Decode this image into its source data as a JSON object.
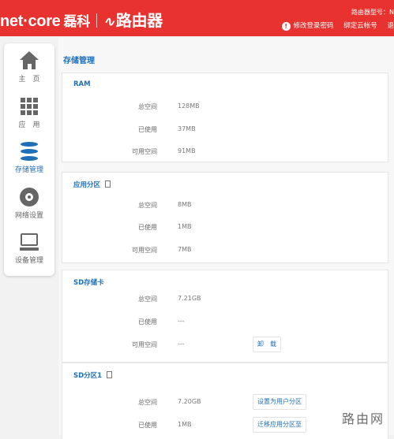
{
  "header": {
    "brand": "net·core",
    "brand_cn": "磊科",
    "product_icon": "∿",
    "product": "路由器",
    "model_label": "路由器型号：N",
    "link_password": "修改登录密码",
    "link_cloud": "绑定云帐号",
    "link_exit": "退"
  },
  "sidebar": {
    "items": [
      {
        "label": "主　页",
        "icon": "home-icon"
      },
      {
        "label": "应　用",
        "icon": "apps-grid-icon"
      },
      {
        "label": "存储管理",
        "icon": "storage-icon"
      },
      {
        "label": "网络设置",
        "icon": "network-gear-icon"
      },
      {
        "label": "设备管理",
        "icon": "device-icon"
      }
    ],
    "active_index": 2
  },
  "main": {
    "title": "存储管理",
    "sections": [
      {
        "title": "RAM",
        "rows": [
          {
            "key": "总空间",
            "value": "128MB"
          },
          {
            "key": "已使用",
            "value": "37MB"
          },
          {
            "key": "可用空间",
            "value": "91MB"
          }
        ]
      },
      {
        "title": "应用分区",
        "rows": [
          {
            "key": "总空间",
            "value": "8MB"
          },
          {
            "key": "已使用",
            "value": "1MB"
          },
          {
            "key": "可用空间",
            "value": "7MB"
          }
        ]
      },
      {
        "title": "SD存储卡",
        "rows": [
          {
            "key": "总空间",
            "value": "7.21GB"
          },
          {
            "key": "已使用",
            "value": "---"
          },
          {
            "key": "可用空间",
            "value": "---",
            "button": "卸　载"
          }
        ]
      },
      {
        "title": "SD分区1",
        "rows": [
          {
            "key": "总空间",
            "value": "7.20GB",
            "button": "设置为用户分区"
          },
          {
            "key": "已使用",
            "value": "1MB",
            "button": "迁移应用分区至"
          }
        ]
      }
    ]
  },
  "watermark": "路由网",
  "colors": {
    "header_red": "#e8322f",
    "accent_blue": "#1d6fb8"
  }
}
